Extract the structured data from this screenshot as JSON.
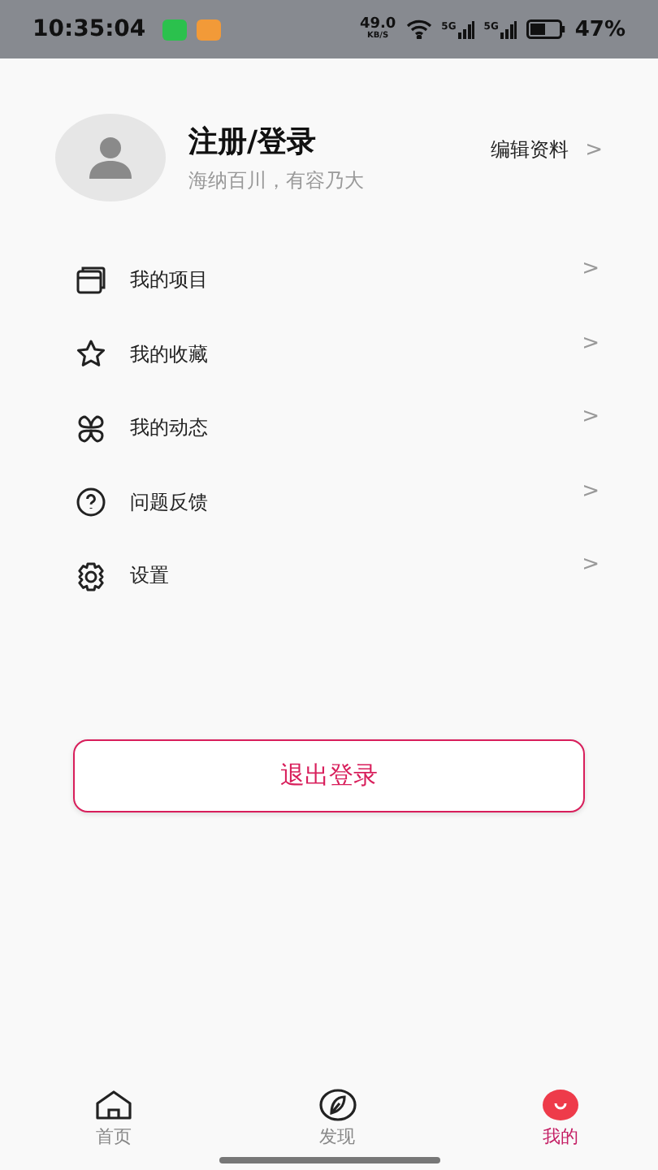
{
  "status_bar": {
    "time": "10:35:04",
    "net_speed": "49.0",
    "net_unit": "KB/S",
    "signal_labels": [
      "5G",
      "5G"
    ],
    "battery": "47%"
  },
  "profile": {
    "name": "注册/登录",
    "motto": "海纳百川，有容乃大",
    "edit_link": "编辑资料",
    "chevron": ">"
  },
  "menu": [
    {
      "kind": "projects",
      "label": "我的项目",
      "chevron": ">"
    },
    {
      "kind": "favorites",
      "label": "我的收藏",
      "chevron": ">"
    },
    {
      "kind": "activity",
      "label": "我的动态",
      "chevron": ">"
    },
    {
      "kind": "feedback",
      "label": "问题反馈",
      "chevron": ">"
    },
    {
      "kind": "settings",
      "label": "设置",
      "chevron": ">"
    }
  ],
  "logout_button": "退出登录",
  "tabs": [
    {
      "kind": "home",
      "label": "首页",
      "selected": false
    },
    {
      "kind": "discover",
      "label": "发现",
      "selected": false
    },
    {
      "kind": "mine",
      "label": "我的",
      "selected": true
    }
  ]
}
